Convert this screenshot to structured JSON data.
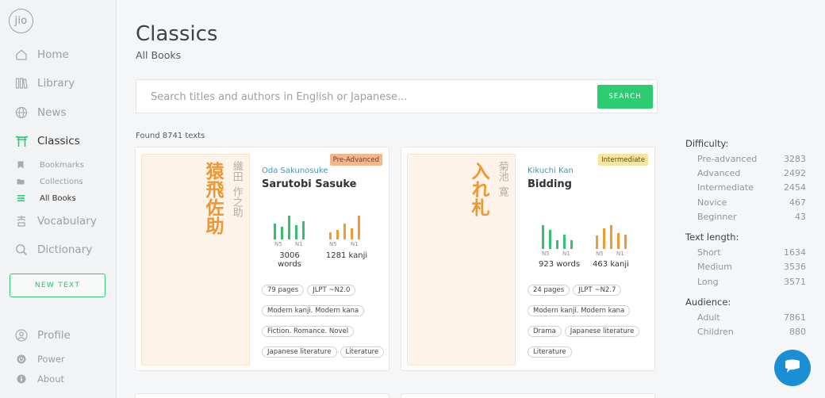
{
  "logo_text": "jio",
  "nav": {
    "home": "Home",
    "library": "Library",
    "news": "News",
    "classics": "Classics",
    "bookmarks": "Bookmarks",
    "collections": "Collections",
    "all_books": "All Books",
    "vocabulary": "Vocabulary",
    "dictionary": "Dictionary",
    "new_text": "NEW TEXT",
    "profile": "Profile",
    "power": "Power",
    "about": "About"
  },
  "page": {
    "title": "Classics",
    "subtitle": "All Books",
    "search_placeholder": "Search titles and authors in English or Japanese...",
    "search_button": "SEARCH",
    "found": "Found 8741 texts"
  },
  "books": [
    {
      "cover_title": "猿飛佐助",
      "cover_author": [
        "織田",
        "作之助"
      ],
      "badge": "Pre-Advanced",
      "author": "Oda Sakunosuke",
      "title": "Sarutobi Sasuke",
      "n5_label": "N5",
      "n1_label": "N1",
      "word_bars": [
        0.62,
        0.5,
        0.95,
        0.55,
        0.72
      ],
      "kanji_bars": [
        0.28,
        0.38,
        0.62,
        0.45,
        0.95
      ],
      "words_stat": "3006 words",
      "kanji_stat": "1281 kanji",
      "tags": [
        "79 pages",
        "JLPT ~N2.0",
        "Modern kanji. Modern kana",
        "Fiction. Romance. Novel",
        "Japanese literature",
        "Literature"
      ]
    },
    {
      "cover_title": "入れ札",
      "cover_author": [
        "菊池",
        "寛"
      ],
      "badge": "Intermediate",
      "author": "Kikuchi Kan",
      "title": "Bidding",
      "n5_label": "N5",
      "n1_label": "N1",
      "word_bars": [
        0.95,
        0.75,
        0.35,
        0.55,
        0.35
      ],
      "kanji_bars": [
        0.52,
        0.8,
        0.95,
        0.62,
        0.55
      ],
      "words_stat": "923 words",
      "kanji_stat": "463 kanji",
      "tags": [
        "24 pages",
        "JLPT ~N2.7",
        "Modern kanji. Modern kana",
        "Drama",
        "Japanese literature",
        "Literature"
      ]
    }
  ],
  "filters": {
    "difficulty": {
      "title": "Difficulty:",
      "rows": [
        {
          "label": "Pre-advanced",
          "count": "3283"
        },
        {
          "label": "Advanced",
          "count": "2492"
        },
        {
          "label": "Intermediate",
          "count": "2454"
        },
        {
          "label": "Novice",
          "count": "467"
        },
        {
          "label": "Beginner",
          "count": "43"
        }
      ]
    },
    "length": {
      "title": "Text length:",
      "rows": [
        {
          "label": "Short",
          "count": "1634"
        },
        {
          "label": "Medium",
          "count": "3536"
        },
        {
          "label": "Long",
          "count": "3571"
        }
      ]
    },
    "audience": {
      "title": "Audience:",
      "rows": [
        {
          "label": "Adult",
          "count": "7861"
        },
        {
          "label": "Children",
          "count": "880"
        }
      ]
    }
  },
  "colors": {
    "accent_green": "#2ecc71",
    "kanji_orange": "#f39a33",
    "author_blue": "#3a97c6",
    "chat_blue": "#1a8fd6"
  }
}
